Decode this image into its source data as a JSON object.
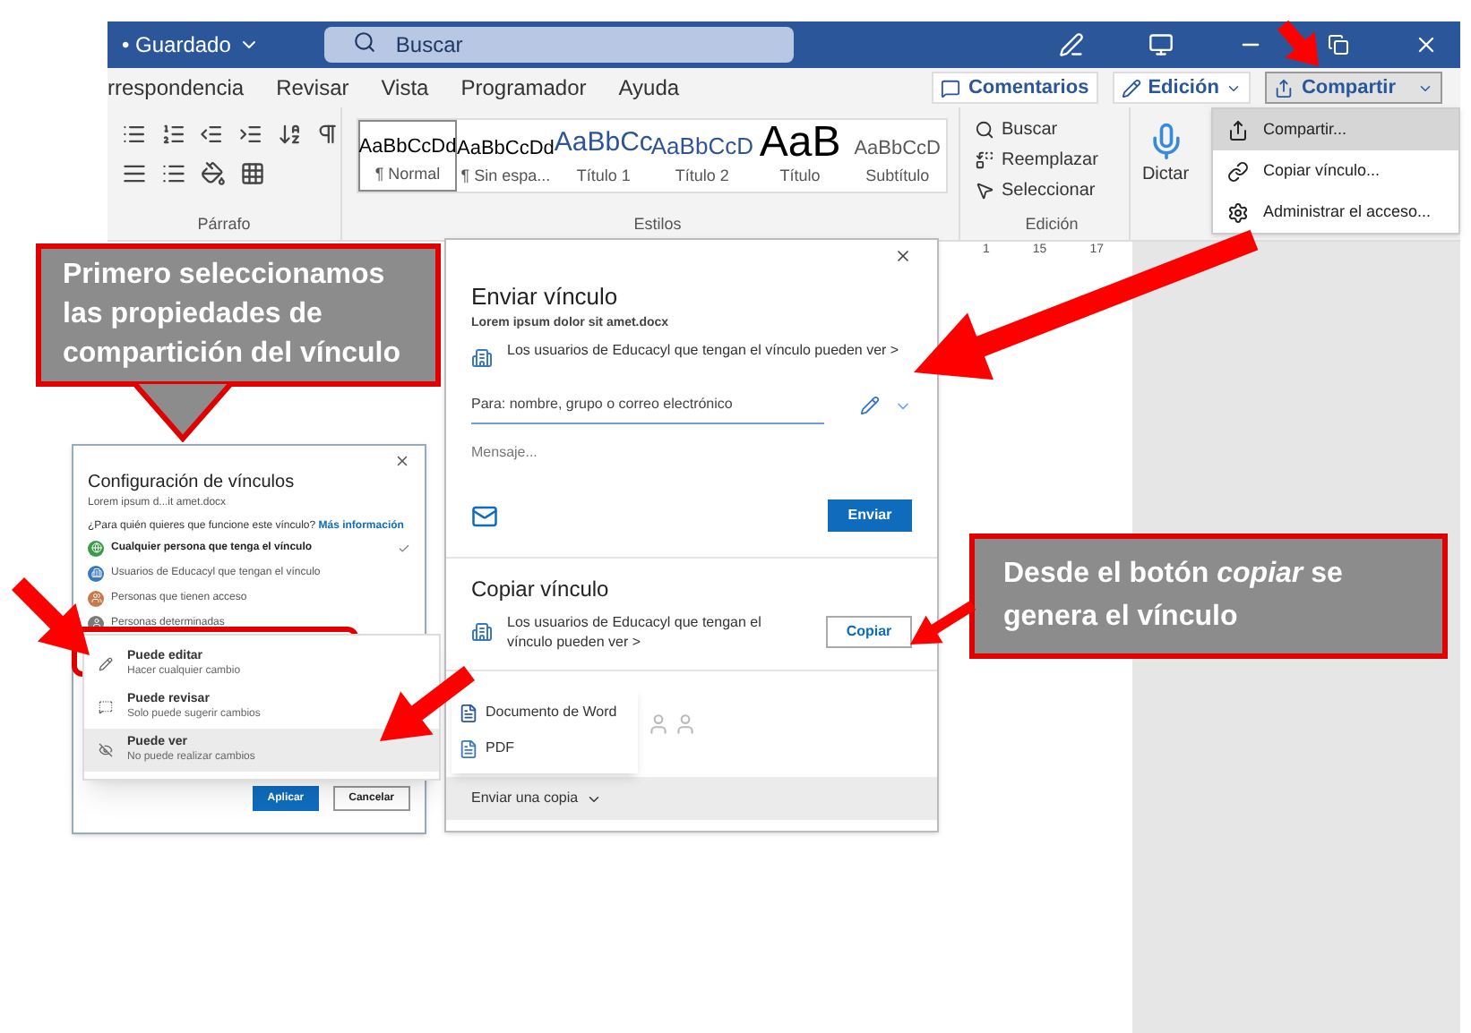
{
  "titlebar": {
    "status": "• Guardado",
    "search_placeholder": "Buscar"
  },
  "menu_tabs": [
    {
      "label": "rrespondencia"
    },
    {
      "label": "Revisar"
    },
    {
      "label": "Vista"
    },
    {
      "label": "Programador"
    },
    {
      "label": "Ayuda"
    }
  ],
  "actions": {
    "comments": "Comentarios",
    "editing": "Edición",
    "share": "Compartir"
  },
  "ribbon": {
    "groups": [
      "Párrafo",
      "Estilos",
      "Edición"
    ],
    "styles": [
      {
        "preview": "AaBbCcDd",
        "name": "¶ Normal",
        "kind": "normal",
        "selected": true
      },
      {
        "preview": "AaBbCcDd",
        "name": "¶ Sin espa...",
        "kind": "normal",
        "selected": false
      },
      {
        "preview": "AaBbCc",
        "name": "Título 1",
        "kind": "heading1",
        "selected": false
      },
      {
        "preview": "AaBbCcD",
        "name": "Título 2",
        "kind": "heading2",
        "selected": false
      },
      {
        "preview": "AaB",
        "name": "Título",
        "kind": "title",
        "selected": false
      },
      {
        "preview": "AaBbCcD",
        "name": "Subtítulo",
        "kind": "subtitle",
        "selected": false
      }
    ],
    "editing": [
      {
        "label": "Buscar",
        "kind": "find"
      },
      {
        "label": "Reemplazar",
        "kind": "replace"
      },
      {
        "label": "Seleccionar",
        "kind": "select"
      }
    ],
    "dictate": "Dictar"
  },
  "ruler": [
    "1",
    "15",
    "17"
  ],
  "share_menu": [
    {
      "label": "Compartir...",
      "kind": "share",
      "selected": true
    },
    {
      "label": "Copiar vínculo...",
      "kind": "link",
      "selected": false
    },
    {
      "label": "Administrar el acceso...",
      "kind": "settings",
      "selected": false
    }
  ],
  "callouts": [
    {
      "text": "Primero seleccionamos las propiedades de compartición del vínculo"
    },
    {
      "text": "Desde el botón *copiar* se genera el vínculo"
    }
  ],
  "link_settings": {
    "title": "Configuración de vínculos",
    "file": "Lorem ipsum d...it amet.docx",
    "question": "¿Para quién quieres que funcione este vínculo?",
    "more_link": "Más información",
    "options": [
      {
        "label": "Cualquier persona que tenga el vínculo",
        "color": "#3c9a4c",
        "selected": true
      },
      {
        "label": "Usuarios de Educacyl que tengan el vínculo",
        "color": "#3a78c2",
        "selected": false
      },
      {
        "label": "Personas que tienen acceso",
        "color": "#c77b4d",
        "selected": false
      },
      {
        "label": "Personas determinadas",
        "color": "#7a7a7a",
        "selected": false
      }
    ],
    "buttons": [
      "Aplicar",
      "Cancelar"
    ]
  },
  "permission_menu": [
    {
      "title": "Puede editar",
      "subtitle": "Hacer cualquier cambio",
      "kind": "edit",
      "selected": false
    },
    {
      "title": "Puede revisar",
      "subtitle": "Solo puede sugerir cambios",
      "kind": "review",
      "selected": false
    },
    {
      "title": "Puede ver",
      "subtitle": "No puede realizar cambios",
      "kind": "view",
      "selected": true
    }
  ],
  "share_dialog": {
    "title": "Enviar vínculo",
    "file": "Lorem ipsum dolor sit amet.docx",
    "scope": "Los usuarios de Educacyl que tengan el vínculo pueden ver >",
    "to_placeholder": "Para: nombre, grupo o correo electrónico",
    "message_placeholder": "Mensaje...",
    "send": "Enviar",
    "copy_title": "Copiar vínculo",
    "copy_scope": "Los usuarios de Educacyl que tengan el vínculo pueden ver >",
    "copy": "Copiar",
    "formats": [
      {
        "label": "Documento de Word",
        "kind": "word"
      },
      {
        "label": "PDF",
        "kind": "pdf"
      }
    ],
    "send_copy": "Enviar una copia"
  }
}
